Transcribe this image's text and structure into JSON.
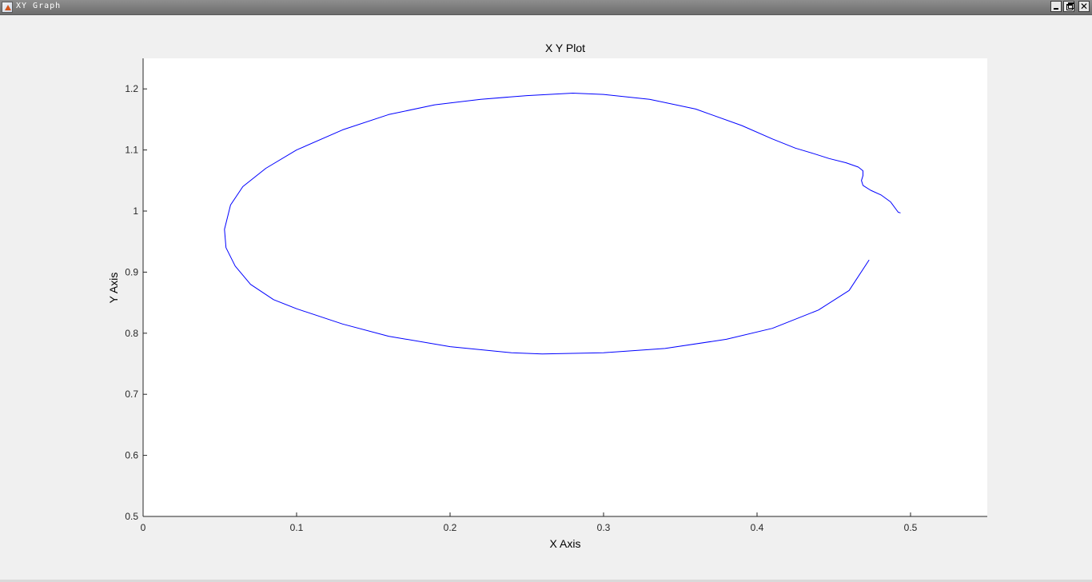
{
  "window": {
    "title": "XY Graph",
    "buttons": {
      "minimize": "minimize",
      "restore": "restore",
      "close": "close"
    }
  },
  "chart_data": {
    "type": "line",
    "title": "X Y Plot",
    "xlabel": "X Axis",
    "ylabel": "Y Axis",
    "xlim": [
      0,
      0.55
    ],
    "ylim": [
      0.5,
      1.25
    ],
    "xticks": [
      0,
      0.1,
      0.2,
      0.3,
      0.4,
      0.5
    ],
    "xtick_labels": [
      "0",
      "0.1",
      "0.2",
      "0.3",
      "0.4",
      "0.5"
    ],
    "yticks": [
      0.5,
      0.6,
      0.7,
      0.8,
      0.9,
      1,
      1.1,
      1.2
    ],
    "ytick_labels": [
      "0.5",
      "0.6",
      "0.7",
      "0.8",
      "0.9",
      "1",
      "1.1",
      "1.2"
    ],
    "grid": false,
    "line_color": "#0000ff",
    "series": [
      {
        "x": [
          0.4935,
          0.492,
          0.487,
          0.481,
          0.474,
          0.469,
          0.468,
          0.469,
          0.469,
          0.466,
          0.458,
          0.447,
          0.437,
          0.425,
          0.41,
          0.39,
          0.36,
          0.33,
          0.3,
          0.28,
          0.25,
          0.22,
          0.19,
          0.16,
          0.13,
          0.1,
          0.08,
          0.065,
          0.057,
          0.053,
          0.054,
          0.06,
          0.07,
          0.085,
          0.1,
          0.13,
          0.16,
          0.2,
          0.24,
          0.26,
          0.3,
          0.34,
          0.38,
          0.41,
          0.44,
          0.46,
          0.473
        ],
        "y": [
          0.997,
          0.998,
          1.015,
          1.026,
          1.034,
          1.042,
          1.05,
          1.058,
          1.066,
          1.072,
          1.079,
          1.086,
          1.094,
          1.103,
          1.118,
          1.14,
          1.167,
          1.183,
          1.191,
          1.193,
          1.189,
          1.183,
          1.174,
          1.158,
          1.133,
          1.1,
          1.07,
          1.04,
          1.01,
          0.97,
          0.94,
          0.91,
          0.88,
          0.855,
          0.84,
          0.815,
          0.795,
          0.778,
          0.768,
          0.766,
          0.768,
          0.775,
          0.79,
          0.808,
          0.838,
          0.87,
          0.92
        ]
      }
    ]
  }
}
